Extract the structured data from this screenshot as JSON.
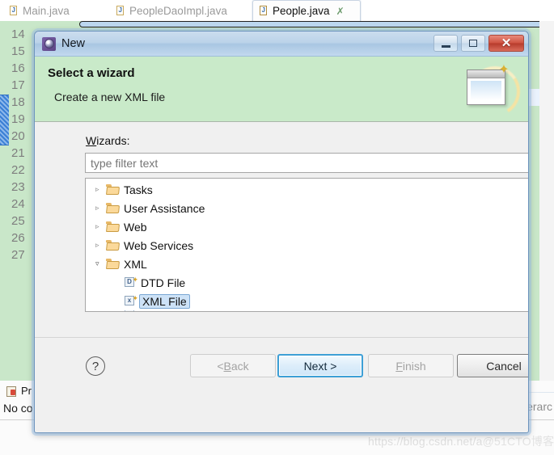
{
  "editor": {
    "tabs": [
      {
        "label": "Main.java",
        "active": false,
        "icon": "java-file-icon",
        "closable": false
      },
      {
        "label": "PeopleDaoImpl.java",
        "active": false,
        "icon": "java-file-warning-icon",
        "closable": false
      },
      {
        "label": "People.java",
        "active": true,
        "icon": "java-file-icon",
        "closable": true,
        "close_glyph": "✗"
      }
    ],
    "line_numbers": [
      "14",
      "15",
      "16",
      "17",
      "18",
      "19",
      "20",
      "21",
      "22",
      "23",
      "24",
      "25",
      "26",
      "27"
    ],
    "gutter_color": "#c9e7c9"
  },
  "bottom_panel": {
    "tab_label": "Pr",
    "message": "No co",
    "right_text": "erarc"
  },
  "watermark": {
    "url_text": "https://blog.csdn.net/a",
    "site_text": "@51CTO博客"
  },
  "dialog": {
    "title": "New",
    "title_icon": "wizard-gear-icon",
    "window_buttons": {
      "minimize": "—",
      "maximize": "□",
      "close": "✕"
    },
    "header": {
      "heading": "Select a wizard",
      "subheading": "Create a new XML file",
      "art_icon": "wizard-sparkle-icon",
      "background": "#c9eac9"
    },
    "wizards_label_pre": "W",
    "wizards_label_post": "izards:",
    "filter": {
      "value": "",
      "placeholder": "type filter text",
      "badge_color": "#c9eac9"
    },
    "tree": [
      {
        "label": "Tasks",
        "level": 0,
        "expanded": false,
        "icon": "folder-icon",
        "selected": false,
        "twisty": "▹"
      },
      {
        "label": "User Assistance",
        "level": 0,
        "expanded": false,
        "icon": "folder-icon",
        "selected": false,
        "twisty": "▹"
      },
      {
        "label": "Web",
        "level": 0,
        "expanded": false,
        "icon": "folder-icon",
        "selected": false,
        "twisty": "▹"
      },
      {
        "label": "Web Services",
        "level": 0,
        "expanded": false,
        "icon": "folder-icon",
        "selected": false,
        "twisty": "▹"
      },
      {
        "label": "XML",
        "level": 0,
        "expanded": true,
        "icon": "folder-icon",
        "selected": false,
        "twisty": "▿"
      },
      {
        "label": "DTD File",
        "level": 1,
        "icon": "dtd-file-icon",
        "glyph": "D",
        "selected": false
      },
      {
        "label": "XML File",
        "level": 1,
        "icon": "xml-file-icon",
        "glyph": "x",
        "selected": true
      }
    ],
    "scrollbar": {
      "up_arrow": "▲",
      "down_arrow": "▼"
    },
    "buttons": {
      "help": "?",
      "back_pre": "< ",
      "back_key": "B",
      "back_post": "ack",
      "next": "Next >",
      "finish_key": "F",
      "finish_post": "inish",
      "cancel": "Cancel"
    },
    "accent_color": "#3d9fd6"
  }
}
